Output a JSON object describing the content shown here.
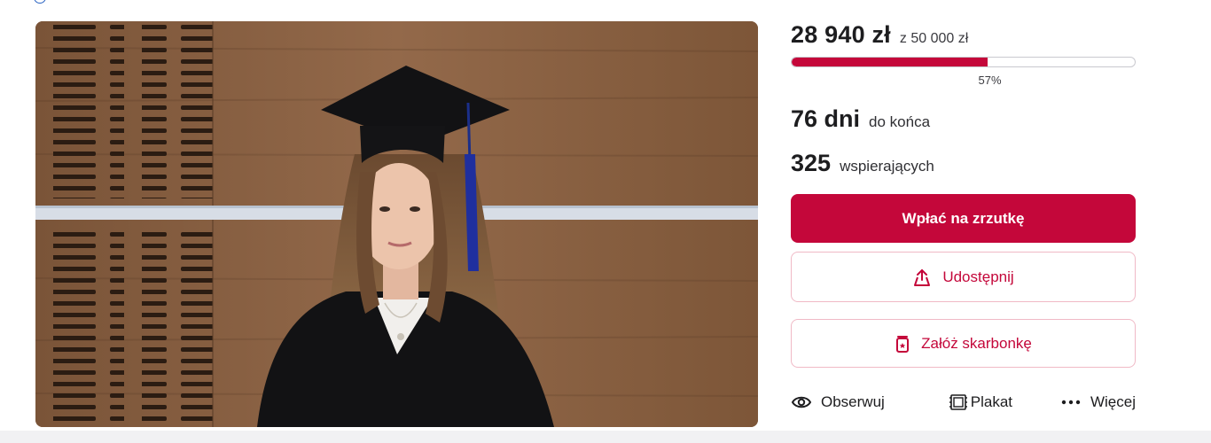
{
  "campaign": {
    "raised": "28 940 zł",
    "goal": "z 50 000 zł",
    "progress_fraction": 0.57,
    "progress_label": "57%",
    "days_value": "76 dni",
    "days_label": "do końca",
    "supporters_value": "325",
    "supporters_label": "wspierających"
  },
  "buttons": {
    "donate": "Wpłać na zrzutkę",
    "share": "Udostępnij",
    "piggy_bank": "Załóż skarbonkę"
  },
  "actions": {
    "follow": "Obserwuj",
    "poster": "Plakat",
    "more": "Więcej"
  },
  "icons": {
    "share": "share-icon",
    "piggy_bank": "piggy-bank-icon",
    "follow": "eye-icon",
    "poster": "poster-icon",
    "more": "more-dots-icon"
  },
  "colors": {
    "brand": "#c4073a",
    "outline_border": "#f0b9c6",
    "link": "#2b64c2"
  }
}
